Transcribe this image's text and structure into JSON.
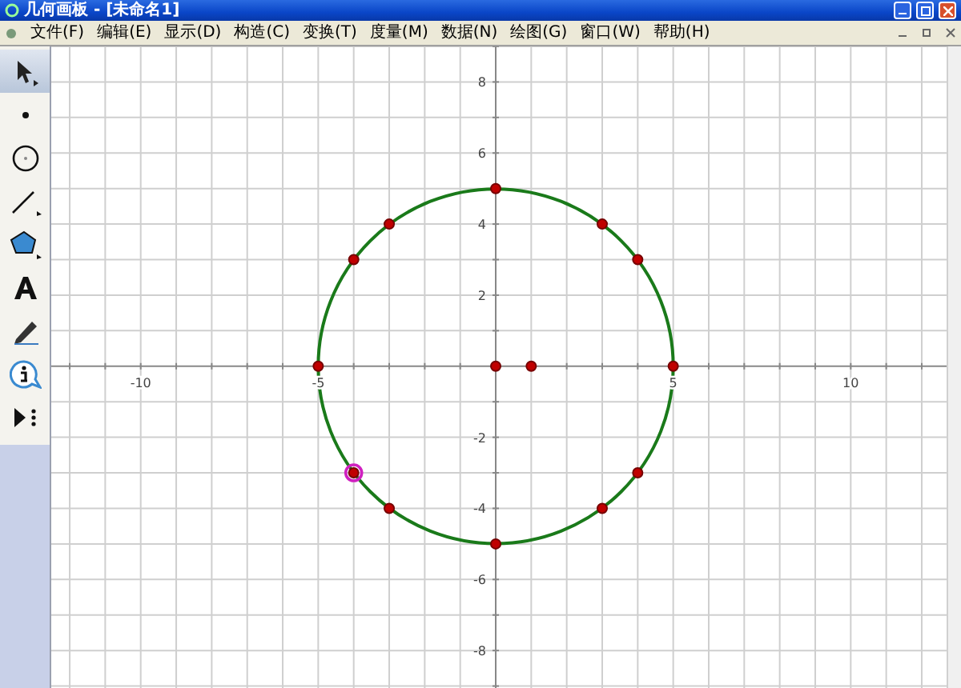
{
  "window": {
    "title": "几何画板 - [未命名1]"
  },
  "menu": [
    "文件(F)",
    "编辑(E)",
    "显示(D)",
    "构造(C)",
    "变换(T)",
    "度量(M)",
    "数据(N)",
    "绘图(G)",
    "窗口(W)",
    "帮助(H)"
  ],
  "tools": [
    {
      "kind": "arrow",
      "selected": true
    },
    {
      "kind": "point",
      "selected": false
    },
    {
      "kind": "compass",
      "selected": false
    },
    {
      "kind": "line",
      "selected": false
    },
    {
      "kind": "polygon",
      "selected": false
    },
    {
      "kind": "text",
      "selected": false
    },
    {
      "kind": "marker",
      "selected": false
    },
    {
      "kind": "info",
      "selected": false
    },
    {
      "kind": "custom",
      "selected": false
    }
  ],
  "canvas": {
    "circle": {
      "color": "#1a7a1a"
    },
    "points": [
      {
        "selected": false
      },
      {
        "selected": false
      },
      {
        "selected": false
      },
      {
        "selected": false
      },
      {
        "selected": false
      },
      {
        "selected": false
      },
      {
        "selected": false
      },
      {
        "selected": false
      },
      {
        "selected": true
      },
      {
        "selected": false
      },
      {
        "selected": false
      },
      {
        "selected": false
      },
      {
        "selected": false
      },
      {
        "selected": false
      }
    ],
    "chart_data": {
      "type": "scatter",
      "grid": true,
      "x": [
        0,
        3,
        4,
        5,
        4,
        3,
        0,
        -3,
        -4,
        -5,
        -4,
        -3,
        0,
        1
      ],
      "series": [
        {
          "color": "#c00000",
          "values": [
            5,
            4,
            3,
            0,
            -3,
            -4,
            -5,
            -4,
            -3,
            0,
            3,
            4,
            0,
            0
          ]
        }
      ],
      "xlim": [
        -12.52,
        12.7
      ],
      "ylim": [
        -9.1,
        9.0
      ],
      "xticks": [
        -10,
        -5,
        5,
        10
      ],
      "yticks": [
        -8,
        -6,
        -4,
        -2,
        2,
        4,
        6,
        8
      ]
    }
  }
}
